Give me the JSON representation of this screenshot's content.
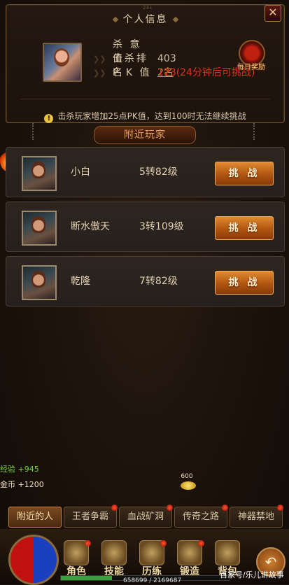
{
  "panel": {
    "title": "个人信息",
    "tiny_number": "23↓",
    "close_label": "✕",
    "stats": [
      {
        "label": "杀 意 值",
        "value": "403"
      },
      {
        "label": "击杀排名",
        "value": "2名"
      },
      {
        "label": "P K 值",
        "value": "123(24分钟后可挑战)"
      }
    ],
    "daily_reward_label": "每日奖励",
    "notice": "击杀玩家增加25点PK值，达到100时无法继续挑战"
  },
  "nearby": {
    "title": "附近玩家",
    "players": [
      {
        "name": "小白",
        "level": "5转82级",
        "button": "挑 战"
      },
      {
        "name": "断水傲天",
        "level": "3转109级",
        "button": "挑 战"
      },
      {
        "name": "乾隆",
        "level": "7转82级",
        "button": "挑 战"
      }
    ]
  },
  "gains": {
    "exp": "经验 +945",
    "gold": "金币  +1200",
    "drop_amount": "600"
  },
  "tabs": [
    {
      "label": "附近的人",
      "active": true,
      "badge": false
    },
    {
      "label": "王者争霸",
      "active": false,
      "badge": true
    },
    {
      "label": "血战矿洞",
      "active": false,
      "badge": true
    },
    {
      "label": "传奇之路",
      "active": false,
      "badge": true
    },
    {
      "label": "神器禁地",
      "active": false,
      "badge": true
    }
  ],
  "menu": [
    {
      "label": "角色",
      "icon": "helmet-icon",
      "badge": true
    },
    {
      "label": "技能",
      "icon": "skill-book-icon",
      "badge": false
    },
    {
      "label": "历练",
      "icon": "training-icon",
      "badge": true
    },
    {
      "label": "锻造",
      "icon": "forge-icon",
      "badge": true
    },
    {
      "label": "背包",
      "icon": "bag-icon",
      "badge": false
    }
  ],
  "exp_bar": {
    "text": "658699 / 2169687",
    "fraction": 0.3036
  },
  "watermark": "百家号/乐儿讲故事",
  "colors": {
    "accent_orange": "#e08a30",
    "pk_red": "#e03020",
    "rank_orange": "#e89030",
    "gain_green": "#7ad040"
  }
}
